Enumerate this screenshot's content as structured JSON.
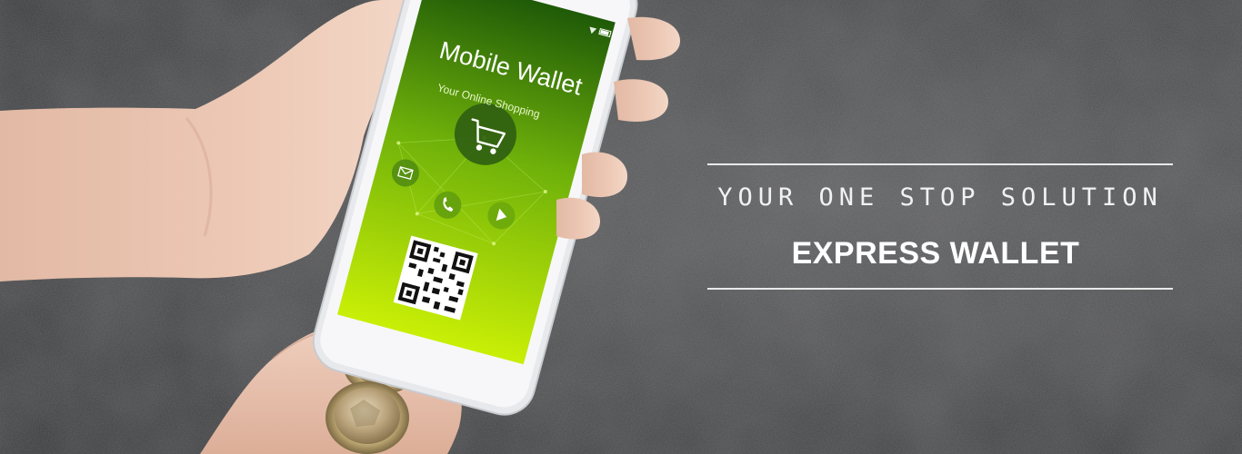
{
  "phone_screen": {
    "title": "Mobile Wallet",
    "subtitle": "Your Online Shopping"
  },
  "banner": {
    "tagline": "YOUR ONE STOP SOLUTION",
    "brand": "EXPRESS WALLET"
  },
  "icons": [
    "cart-icon",
    "mail-icon",
    "phone-icon",
    "play-icon",
    "qr-code"
  ],
  "colors": {
    "background": "#3c3d3f",
    "screen_green_dark": "#2e6b0a",
    "screen_green_light": "#c8f000",
    "text": "#ffffff"
  }
}
